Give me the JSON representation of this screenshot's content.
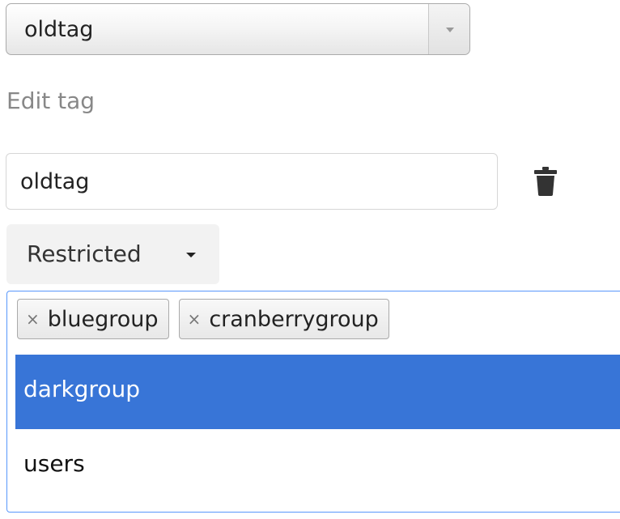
{
  "tag_select": {
    "value": "oldtag"
  },
  "edit": {
    "label": "Edit tag",
    "tag_name_value": "oldtag"
  },
  "visibility": {
    "label": "Restricted"
  },
  "groups": {
    "selected": [
      {
        "label": "bluegroup",
        "remove_glyph": "×"
      },
      {
        "label": "cranberrygroup",
        "remove_glyph": "×"
      }
    ],
    "options": [
      {
        "label": "darkgroup",
        "highlighted": true
      },
      {
        "label": "users",
        "highlighted": false
      }
    ]
  },
  "colors": {
    "highlight": "#3875d7",
    "focus_border": "#5897fb"
  },
  "icons": {
    "delete": "trash-icon",
    "dropdown": "chevron-down-icon"
  }
}
